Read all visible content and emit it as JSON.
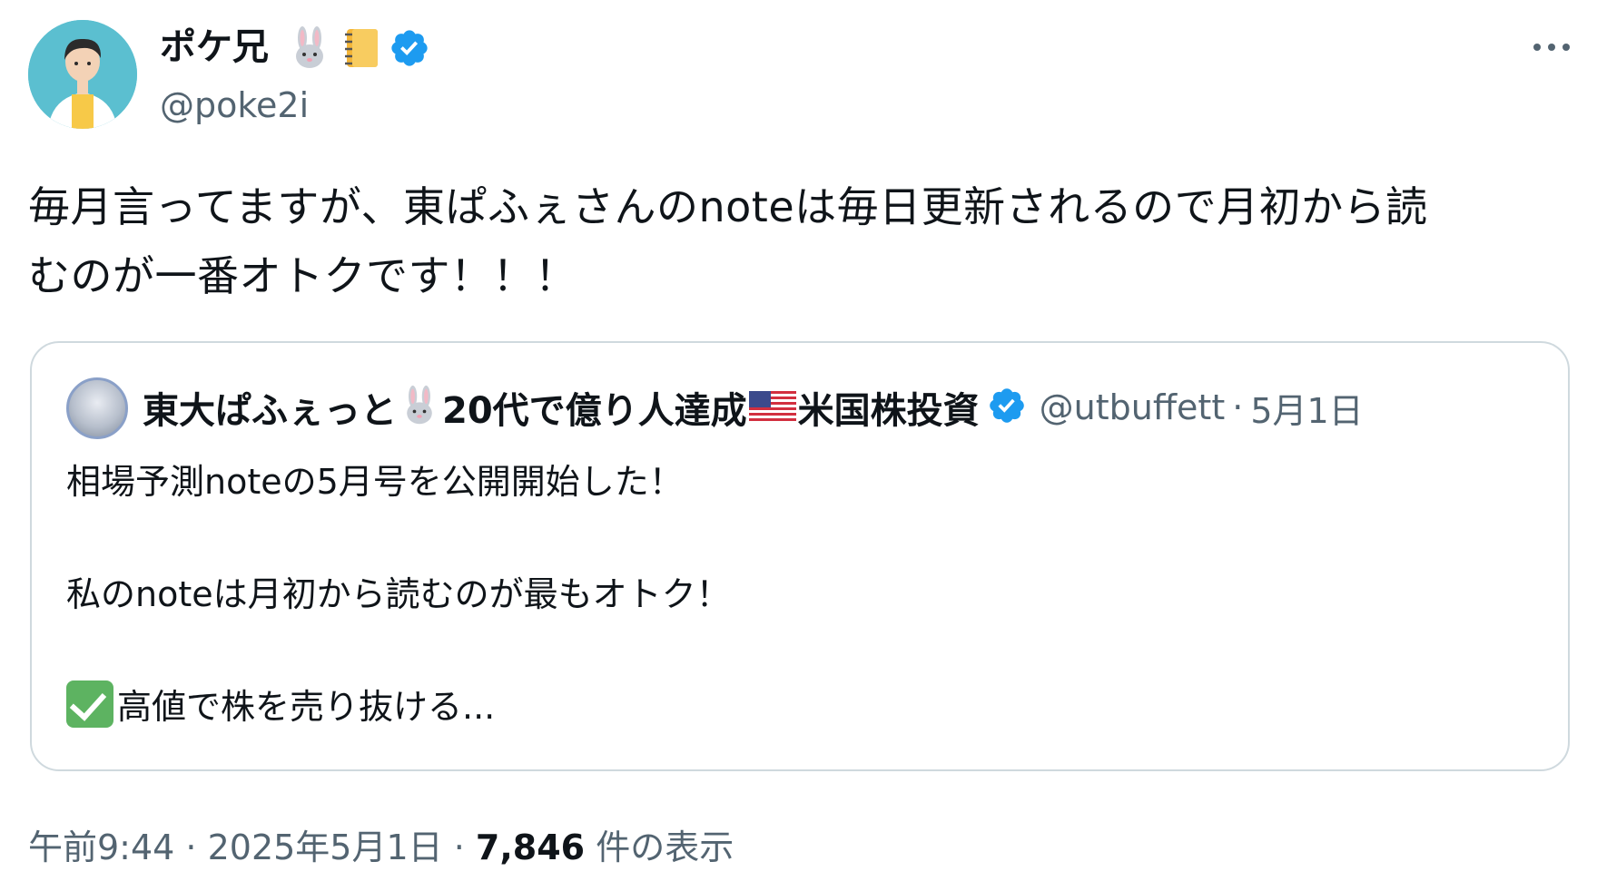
{
  "tweet": {
    "author": {
      "name": "ポケ兄",
      "handle": "@poke2i",
      "name_emojis": [
        "rabbit-icon",
        "notebook-icon"
      ],
      "verified": true
    },
    "more_label": "•••",
    "text_line1": "毎月言ってますが、東ぱふぇさんのnoteは毎日更新されるので月初から読",
    "text_line2": "むのが一番オトクです！！！",
    "quote": {
      "name_part1": "東大ぱふぇっと",
      "name_part2": "20代で億り人達成",
      "name_part3": "米国株投資",
      "handle": "@utbuffett",
      "separator": "·",
      "date": "5月1日",
      "verified": true,
      "line1": "相場予測noteの5月号を公開開始した！",
      "line2": "私のnoteは月初から読むのが最もオトク！",
      "line3": "高値で株を売り抜ける..."
    },
    "meta": {
      "time": "午前9:44",
      "sep1": " · ",
      "date": "2025年5月1日",
      "sep2": " · ",
      "views": "7,846",
      "views_label": " 件の表示"
    },
    "colors": {
      "verified_blue": "#1d9bf0",
      "secondary_text": "#536471",
      "border": "#cfd9de",
      "avatar_bg": "#5bbfd0"
    }
  }
}
